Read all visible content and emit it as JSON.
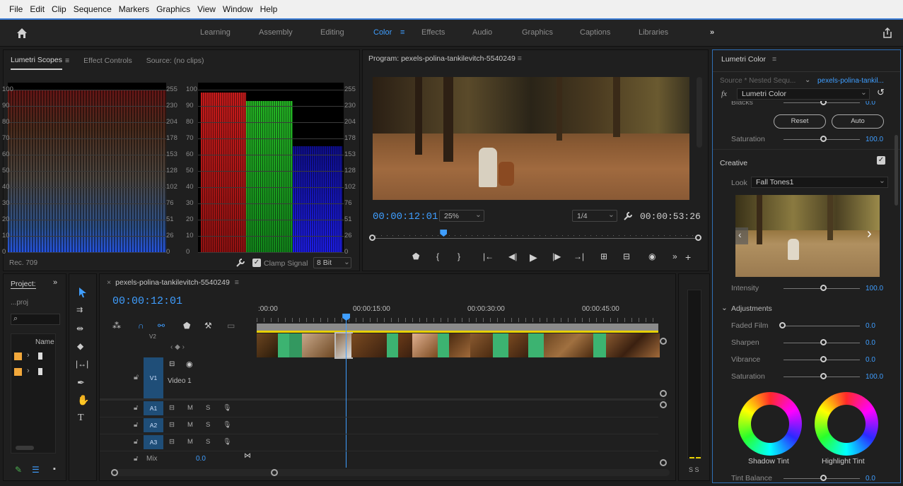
{
  "menu": [
    "File",
    "Edit",
    "Clip",
    "Sequence",
    "Markers",
    "Graphics",
    "View",
    "Window",
    "Help"
  ],
  "workspaces": [
    "Learning",
    "Assembly",
    "Editing",
    "Color",
    "Effects",
    "Audio",
    "Graphics",
    "Captions",
    "Libraries"
  ],
  "active_workspace": "Color",
  "scopes": {
    "tabs": [
      "Lumetri Scopes",
      "Effect Controls",
      "Source: (no clips)"
    ],
    "left_scale": [
      "100",
      "90",
      "80",
      "70",
      "60",
      "50",
      "40",
      "30",
      "20",
      "10",
      "0"
    ],
    "right_scale": [
      "255",
      "230",
      "204",
      "178",
      "153",
      "128",
      "102",
      "76",
      "51",
      "26",
      "0"
    ],
    "rec": "Rec. 709",
    "clamp_label": "Clamp Signal",
    "bit_depth": "8 Bit"
  },
  "program": {
    "title": "Program: pexels-polina-tankilevitch-5540249",
    "timecode": "00:00:12:01",
    "zoom": "25%",
    "resolution": "1/4",
    "duration": "00:00:53:26",
    "playhead_fraction": 0.223
  },
  "project": {
    "title": "Project:",
    "file": "...proj",
    "name_header": "Name"
  },
  "timeline": {
    "sequence": "pexels-polina-tankilevitch-5540249",
    "timecode": "00:00:12:01",
    "ruler": [
      ":00:00",
      "00:00:15:00",
      "00:00:30:00",
      "00:00:45:00"
    ],
    "tracks": {
      "v2": "V2",
      "v1": "V1",
      "video1": "Video 1",
      "a1": "A1",
      "a2": "A2",
      "a3": "A3",
      "m": "M",
      "s": "S",
      "mix": "Mix",
      "mix_value": "0.0"
    },
    "playhead_fraction": 0.223
  },
  "meter": {
    "labels": "S S"
  },
  "lumetri": {
    "title": "Lumetri Color",
    "source": "Source * Nested Sequ...",
    "clip": "pexels-polina-tankil...",
    "effect": "Lumetri Color",
    "blacks_label": "Blacks",
    "blacks_value": "0.0",
    "reset": "Reset",
    "auto": "Auto",
    "saturation_label": "Saturation",
    "saturation_value": "100.0",
    "creative": "Creative",
    "look_label": "Look",
    "look_value": "Fall Tones1",
    "intensity_label": "Intensity",
    "intensity_value": "100.0",
    "adjustments": "Adjustments",
    "faded_film": "Faded Film",
    "faded_value": "0.0",
    "sharpen": "Sharpen",
    "sharpen_value": "0.0",
    "vibrance": "Vibrance",
    "vibrance_value": "0.0",
    "adj_saturation": "Saturation",
    "adj_saturation_value": "100.0",
    "shadow_tint": "Shadow Tint",
    "highlight_tint": "Highlight Tint",
    "tint_balance": "Tint Balance",
    "tint_value": "0.0"
  },
  "colors": {
    "accent": "#3f9eff",
    "track_blue": "#1f4e78",
    "clip_green": "#3cb371"
  }
}
